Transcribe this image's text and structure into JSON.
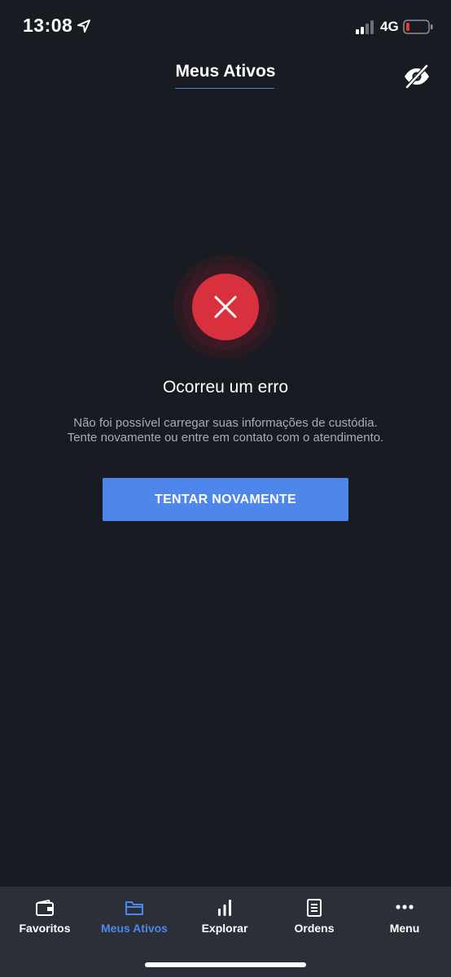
{
  "status_bar": {
    "time": "13:08",
    "network": "4G",
    "battery_color": "#e5392e"
  },
  "header": {
    "title": "Meus Ativos",
    "hide_icon": "eye-off-icon",
    "accent_color": "#4a7fd6"
  },
  "error": {
    "icon": "close-icon",
    "title": "Ocorreu um erro",
    "message": "Não foi possível carregar suas informações de custódia. Tente novamente ou entre em contato com o atendimento.",
    "retry_label": "TENTAR NOVAMENTE",
    "badge_color": "#d9303d",
    "button_color": "#4f86ec"
  },
  "tab_bar": {
    "items": [
      {
        "label": "Favoritos",
        "icon": "wallet-icon",
        "active": false
      },
      {
        "label": "Meus Ativos",
        "icon": "folder-icon",
        "active": true
      },
      {
        "label": "Explorar",
        "icon": "bar-chart-icon",
        "active": false
      },
      {
        "label": "Ordens",
        "icon": "document-icon",
        "active": false
      },
      {
        "label": "Menu",
        "icon": "more-icon",
        "active": false
      }
    ]
  }
}
